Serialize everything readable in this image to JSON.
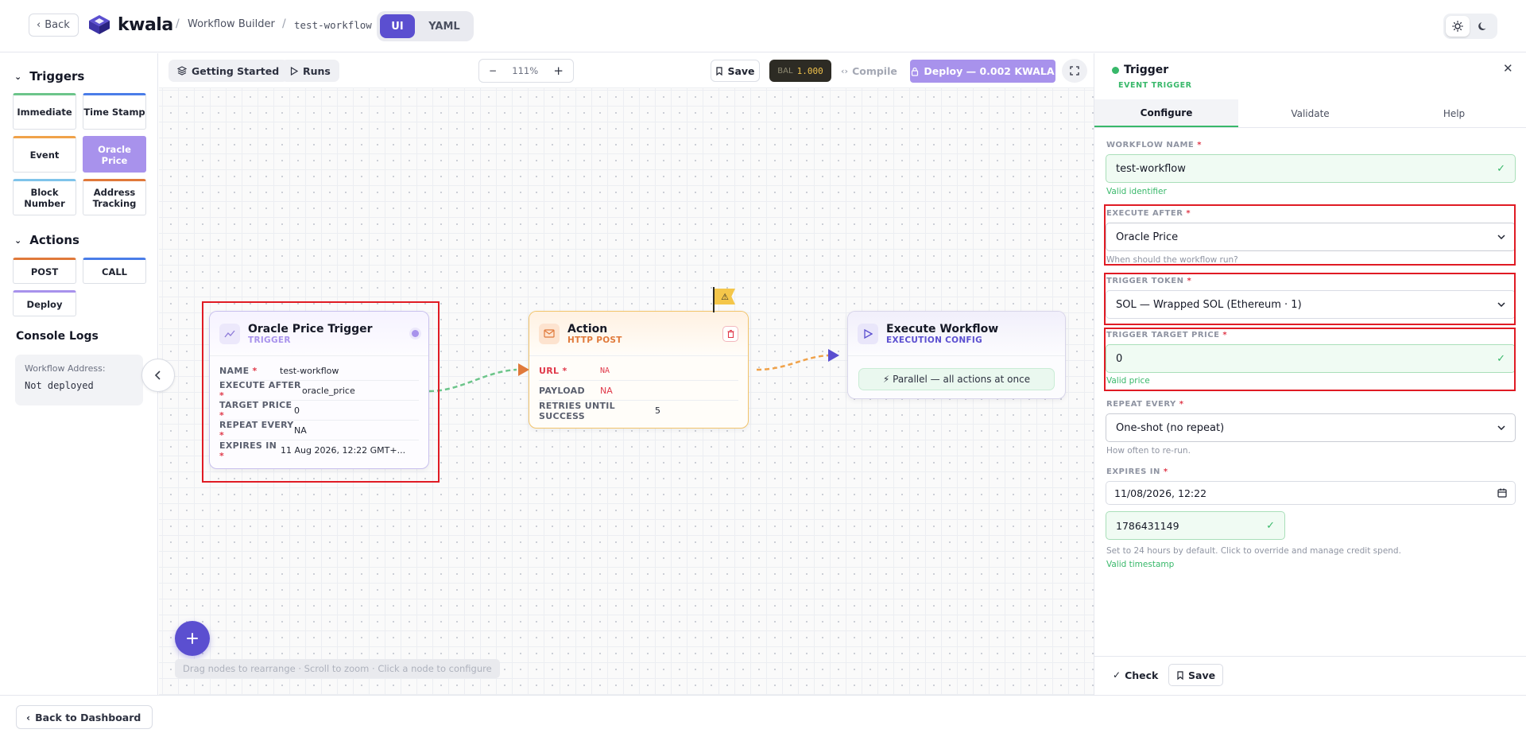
{
  "header": {
    "back_label": "Back",
    "brand": "kwala",
    "breadcrumb_builder": "Workflow Builder",
    "breadcrumb_sep": "/",
    "workflow_slug": "test-workflow",
    "mode_ui": "UI",
    "mode_yaml": "YAML"
  },
  "sidebar": {
    "triggers_title": "Triggers",
    "triggers": [
      {
        "label": "Immediate",
        "color": "#6cc58a"
      },
      {
        "label": "Time Stamp",
        "color": "#4a7de8"
      },
      {
        "label": "Event",
        "color": "#f0a24a"
      },
      {
        "label": "Oracle Price",
        "color": "#a892ec"
      },
      {
        "label": "Block Number",
        "color": "#7fc4ea"
      },
      {
        "label": "Address Tracking",
        "color": "#e0793a"
      }
    ],
    "actions_title": "Actions",
    "actions": [
      {
        "label": "POST",
        "color": "#e0793a"
      },
      {
        "label": "CALL",
        "color": "#4a7de8"
      },
      {
        "label": "Deploy",
        "color": "#a892ec"
      }
    ],
    "console_title": "Console Logs",
    "console_label": "Workflow Address:",
    "console_value": "Not deployed"
  },
  "toolbar": {
    "getting_started": "Getting Started",
    "runs": "Runs",
    "zoom_minus": "−",
    "zoom_level": "111%",
    "zoom_plus": "+",
    "save": "Save",
    "bal_label": "BAL",
    "bal_value": "1.000",
    "compile": "Compile",
    "deploy": "Deploy — 0.002 KWALA"
  },
  "canvas": {
    "trigger_node": {
      "title": "Oracle Price Trigger",
      "subtitle": "TRIGGER",
      "rows": [
        {
          "key": "NAME",
          "value": "test-workflow"
        },
        {
          "key": "EXECUTE AFTER",
          "value": "oracle_price"
        },
        {
          "key": "TARGET PRICE",
          "value": "0"
        },
        {
          "key": "REPEAT EVERY",
          "value": "NA"
        },
        {
          "key": "EXPIRES IN",
          "value": "11 Aug 2026, 12:22 GMT+..."
        }
      ]
    },
    "action_node": {
      "title": "Action",
      "subtitle": "HTTP POST",
      "rows": [
        {
          "key": "URL",
          "value": "NA"
        },
        {
          "key": "PAYLOAD",
          "value": "NA"
        },
        {
          "key": "RETRIES UNTIL SUCCESS",
          "value": "5"
        }
      ],
      "warning_glyph": "⚠"
    },
    "exec_node": {
      "title": "Execute Workflow",
      "subtitle": "EXECUTION CONFIG",
      "mode": "⚡ Parallel — all actions at once"
    },
    "hint": "Drag nodes to rearrange · Scroll to zoom · Click a node to configure",
    "fab": "+"
  },
  "panel": {
    "title": "Trigger",
    "subtitle": "EVENT TRIGGER",
    "tabs": [
      "Configure",
      "Validate",
      "Help"
    ],
    "workflow_name_label": "WORKFLOW NAME",
    "workflow_name_value": "test-workflow",
    "workflow_name_note": "Valid identifier",
    "execute_after_label": "EXECUTE AFTER",
    "execute_after_value": "Oracle Price",
    "execute_after_note": "When should the workflow run?",
    "trigger_token_label": "TRIGGER TOKEN",
    "trigger_token_value": "SOL — Wrapped SOL (Ethereum · 1)",
    "target_price_label": "TRIGGER TARGET PRICE",
    "target_price_value": "0",
    "target_price_note": "Valid price",
    "repeat_label": "REPEAT EVERY",
    "repeat_value": "One-shot (no repeat)",
    "repeat_note": "How often to re-run.",
    "expires_label": "EXPIRES IN",
    "expires_datetime": "11/08/2026, 12:22",
    "expires_timestamp": "1786431149",
    "expires_note": "Set to 24 hours by default. Click to override and manage credit spend.",
    "expires_valid": "Valid timestamp",
    "check_label": "Check",
    "save_label": "Save",
    "required_mark": "*",
    "ok_mark": "✓"
  },
  "footer": {
    "back_dashboard": "Back to Dashboard"
  },
  "colors": {
    "accent": "#5b4fd0",
    "deploy": "#a892ec",
    "valid": "#38b86a",
    "highlight": "#e01b24",
    "action": "#f0a24a"
  }
}
